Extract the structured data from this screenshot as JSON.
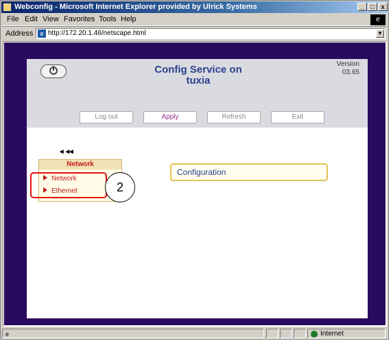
{
  "window": {
    "title": "Webconfig - Microsoft Internet Explorer provided by Ulrick Systems",
    "controls": {
      "minimize": "_",
      "maximize": "□",
      "close": "x"
    }
  },
  "menu": [
    "File",
    "Edit",
    "View",
    "Favorites",
    "Tools",
    "Help"
  ],
  "address": {
    "label": "Address",
    "url": "http://172.20.1.46/netscape.html"
  },
  "app": {
    "title_line1": "Config Service on",
    "title_line2": "tuxia",
    "version_label": "Version",
    "version_value": "03.65",
    "buttons": {
      "logout": "Log out",
      "apply": "Apply",
      "refresh": "Refresh",
      "exit": "Exit"
    },
    "nav_arrows": "◂ ◂◂",
    "tree": {
      "header": "Network",
      "items": [
        "Network",
        "Ethernet"
      ]
    },
    "callout": "2",
    "main_heading": "Configuration"
  },
  "status": {
    "zone": "Internet"
  },
  "colors": {
    "frame_purple": "#2a0a5e",
    "title_blue": "#2c3e8c",
    "tree_red": "#c21b1b"
  }
}
